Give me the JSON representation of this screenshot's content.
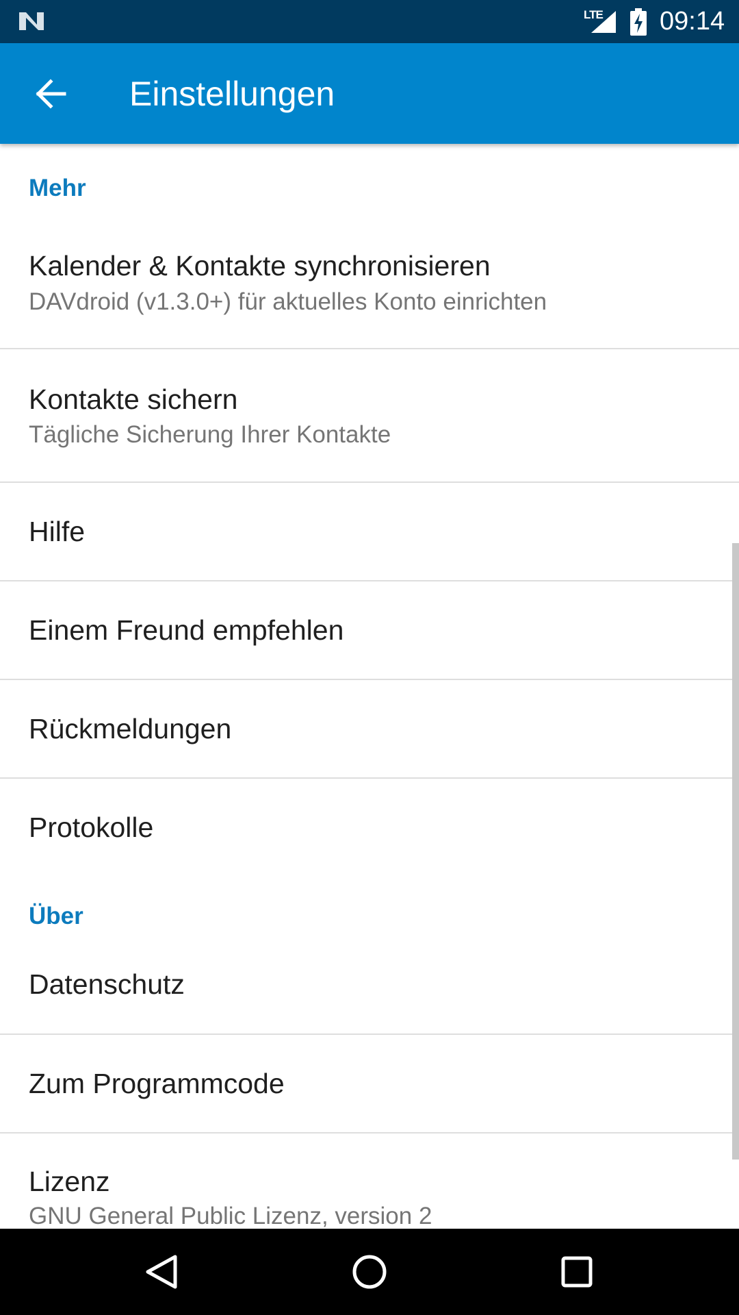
{
  "status_bar": {
    "network": "LTE",
    "time": "09:14",
    "icons": [
      "notification-n-icon",
      "signal-icon",
      "battery-charging-icon"
    ]
  },
  "app_bar": {
    "title": "Einstellungen",
    "back_icon": "arrow-back-icon"
  },
  "colors": {
    "status_bar": "#013a5f",
    "app_bar": "#0185cc",
    "section_header": "#0c7bbd"
  },
  "sections": [
    {
      "header": "Mehr",
      "items": [
        {
          "title": "Kalender & Kontakte synchronisieren",
          "subtitle": "DAVdroid (v1.3.0+) für aktuelles Konto einrichten"
        },
        {
          "title": "Kontakte sichern",
          "subtitle": "Tägliche Sicherung Ihrer Kontakte"
        },
        {
          "title": "Hilfe"
        },
        {
          "title": "Einem Freund empfehlen"
        },
        {
          "title": "Rückmeldungen"
        },
        {
          "title": "Protokolle"
        }
      ]
    },
    {
      "header": "Über",
      "items": [
        {
          "title": "Datenschutz"
        },
        {
          "title": "Zum Programmcode"
        },
        {
          "title": "Lizenz",
          "subtitle": "GNU General Public Lizenz, version 2"
        }
      ]
    }
  ],
  "nav_bar": [
    "back-triangle-icon",
    "home-circle-icon",
    "recents-square-icon"
  ]
}
